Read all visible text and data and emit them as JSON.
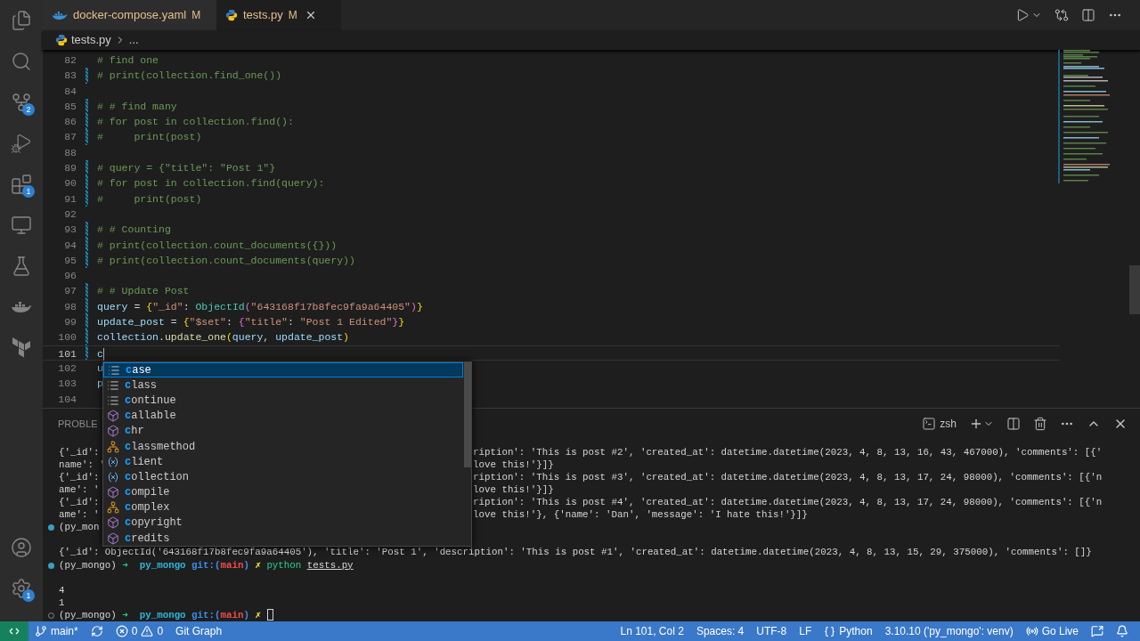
{
  "activity_bar": {
    "top": [
      {
        "kind": "explorer",
        "selected": false
      },
      {
        "kind": "search",
        "selected": false
      },
      {
        "kind": "source_control",
        "selected": false,
        "badge": "2"
      },
      {
        "kind": "run",
        "selected": false
      },
      {
        "kind": "extensions",
        "selected": false,
        "badge": "1"
      },
      {
        "kind": "remote",
        "selected": false
      },
      {
        "kind": "testing",
        "selected": false
      },
      {
        "kind": "docker",
        "selected": false
      },
      {
        "kind": "terraform",
        "selected": false
      }
    ],
    "bottom": [
      {
        "kind": "account",
        "selected": false
      },
      {
        "kind": "settings",
        "selected": false,
        "badge": "1"
      }
    ]
  },
  "tabs": [
    {
      "label": "docker-compose.yaml",
      "kind": "docker",
      "badge": "M",
      "selected": false,
      "closable": false
    },
    {
      "label": "tests.py",
      "kind": "python",
      "badge": "M",
      "selected": true,
      "closable": true
    }
  ],
  "breadcrumbs": [
    "tests.py",
    "..."
  ],
  "editor": {
    "lines": [
      {
        "number": "82",
        "changed": false,
        "current": false,
        "tokens": [
          {
            "kind": "comment",
            "text": "# find one"
          }
        ]
      },
      {
        "number": "83",
        "changed": true,
        "current": false,
        "tokens": [
          {
            "kind": "comment",
            "text": "# print(collection.find_one())"
          }
        ]
      },
      {
        "number": "84",
        "changed": false,
        "current": false
      },
      {
        "number": "85",
        "changed": true,
        "current": false,
        "tokens": [
          {
            "kind": "comment",
            "text": "# # find many"
          }
        ]
      },
      {
        "number": "86",
        "changed": true,
        "current": false,
        "tokens": [
          {
            "kind": "comment",
            "text": "# for post in collection.find():"
          }
        ]
      },
      {
        "number": "87",
        "changed": true,
        "current": false,
        "tokens": [
          {
            "kind": "comment",
            "text": "#     print(post)"
          }
        ]
      },
      {
        "number": "88",
        "changed": false,
        "current": false
      },
      {
        "number": "89",
        "changed": true,
        "current": false,
        "tokens": [
          {
            "kind": "comment",
            "text": "# query = {\"title\": \"Post 1\"}"
          }
        ]
      },
      {
        "number": "90",
        "changed": true,
        "current": false,
        "tokens": [
          {
            "kind": "comment",
            "text": "# for post in collection.find(query):"
          }
        ]
      },
      {
        "number": "91",
        "changed": true,
        "current": false,
        "tokens": [
          {
            "kind": "comment",
            "text": "#     print(post)"
          }
        ]
      },
      {
        "number": "92",
        "changed": false,
        "current": false
      },
      {
        "number": "93",
        "changed": true,
        "current": false,
        "tokens": [
          {
            "kind": "comment",
            "text": "# # Counting"
          }
        ]
      },
      {
        "number": "94",
        "changed": true,
        "current": false,
        "tokens": [
          {
            "kind": "comment",
            "text": "# print(collection.count_documents({}))"
          }
        ]
      },
      {
        "number": "95",
        "changed": true,
        "current": false,
        "tokens": [
          {
            "kind": "comment",
            "text": "# print(collection.count_documents(query))"
          }
        ]
      },
      {
        "number": "96",
        "changed": false,
        "current": false
      },
      {
        "number": "97",
        "changed": true,
        "current": false,
        "tokens": [
          {
            "kind": "comment",
            "text": "# # Update Post"
          }
        ]
      },
      {
        "number": "98",
        "changed": true,
        "current": false,
        "tokens": [
          {
            "kind": "var",
            "text": "query"
          },
          {
            "kind": "plain",
            "text": " = "
          },
          {
            "kind": "brace1",
            "text": "{"
          },
          {
            "kind": "string",
            "text": "\"_id\""
          },
          {
            "kind": "plain",
            "text": ": "
          },
          {
            "kind": "class",
            "text": "ObjectId"
          },
          {
            "kind": "brace2",
            "text": "("
          },
          {
            "kind": "string",
            "text": "\"643168f17b8fec9fa9a64405\""
          },
          {
            "kind": "brace2",
            "text": ")"
          },
          {
            "kind": "brace1",
            "text": "}"
          }
        ]
      },
      {
        "number": "99",
        "changed": true,
        "current": false,
        "tokens": [
          {
            "kind": "var",
            "text": "update_post"
          },
          {
            "kind": "plain",
            "text": " = "
          },
          {
            "kind": "brace1",
            "text": "{"
          },
          {
            "kind": "string",
            "text": "\"$set\""
          },
          {
            "kind": "plain",
            "text": ": "
          },
          {
            "kind": "brace2",
            "text": "{"
          },
          {
            "kind": "string",
            "text": "\"title\""
          },
          {
            "kind": "plain",
            "text": ": "
          },
          {
            "kind": "string",
            "text": "\"Post 1 Edited\""
          },
          {
            "kind": "brace2",
            "text": "}"
          },
          {
            "kind": "brace1",
            "text": "}"
          }
        ]
      },
      {
        "number": "100",
        "changed": true,
        "current": false,
        "tokens": [
          {
            "kind": "var",
            "text": "collection"
          },
          {
            "kind": "plain",
            "text": "."
          },
          {
            "kind": "fn",
            "text": "update_one"
          },
          {
            "kind": "brace1",
            "text": "("
          },
          {
            "kind": "var",
            "text": "query"
          },
          {
            "kind": "plain",
            "text": ", "
          },
          {
            "kind": "var",
            "text": "update_post"
          },
          {
            "kind": "brace1",
            "text": ")"
          }
        ]
      },
      {
        "number": "101",
        "changed": true,
        "current": true,
        "tokens": [
          {
            "kind": "var",
            "text": "c"
          }
        ]
      },
      {
        "number": "102",
        "changed": false,
        "current": false,
        "tokens": [
          {
            "kind": "var",
            "text": "u"
          }
        ]
      },
      {
        "number": "103",
        "changed": false,
        "current": false,
        "tokens": [
          {
            "kind": "var",
            "text": "p"
          }
        ]
      },
      {
        "number": "104",
        "changed": false,
        "current": false
      }
    ]
  },
  "suggestions": [
    {
      "kind": "keyword",
      "match": "c",
      "rest": "ase",
      "selected": true
    },
    {
      "kind": "keyword",
      "match": "c",
      "rest": "lass",
      "selected": false
    },
    {
      "kind": "keyword",
      "match": "c",
      "rest": "ontinue",
      "selected": false
    },
    {
      "kind": "function",
      "match": "c",
      "rest": "allable",
      "selected": false
    },
    {
      "kind": "function",
      "match": "c",
      "rest": "hr",
      "selected": false
    },
    {
      "kind": "class",
      "match": "c",
      "rest": "lassmethod",
      "selected": false
    },
    {
      "kind": "variable",
      "match": "c",
      "rest": "lient",
      "selected": false
    },
    {
      "kind": "variable",
      "match": "c",
      "rest": "ollection",
      "selected": false
    },
    {
      "kind": "function",
      "match": "c",
      "rest": "ompile",
      "selected": false
    },
    {
      "kind": "class",
      "match": "c",
      "rest": "omplex",
      "selected": false
    },
    {
      "kind": "function",
      "match": "c",
      "rest": "opyright",
      "selected": false
    },
    {
      "kind": "function",
      "match": "c",
      "rest": "redits",
      "selected": false
    }
  ],
  "panel": {
    "tab": "PROBLE",
    "shell": "zsh",
    "rows": [
      {
        "kind": "split",
        "left": "{'_id':",
        "right": "ription': 'This is post #2', 'created_at': datetime.datetime(2023, 4, 8, 13, 16, 43, 467000), 'comments': [{'"
      },
      {
        "kind": "split",
        "left": "name': '",
        "right": "love this!'}]}"
      },
      {
        "kind": "split",
        "left": "{'_id':",
        "right": "ription': 'This is post #3', 'created_at': datetime.datetime(2023, 4, 8, 13, 17, 24, 98000), 'comments': [{'n"
      },
      {
        "kind": "split",
        "left": "ame': '",
        "right": "love this!'}]}"
      },
      {
        "kind": "split",
        "left": "{'_id':",
        "right": "ription': 'This is post #4', 'created_at': datetime.datetime(2023, 4, 8, 13, 17, 24, 98000), 'comments': [{'n"
      },
      {
        "kind": "split",
        "left": "ame': '",
        "right": "love this!'}, {'name': 'Dan', 'message': 'I hate this!'}]}"
      },
      {
        "kind": "split",
        "done": true,
        "left": "(py_mon"
      },
      {
        "kind": "gap"
      },
      {
        "kind": "output",
        "text": "{'_id': ObjectId('643168f17b8fec9fa9a64405'), 'title': 'Post 1', 'description': 'This is post #1', 'created_at': datetime.datetime(2023, 4, 8, 13, 15, 29, 375000), 'comments': []}"
      },
      {
        "kind": "prompt",
        "done": true,
        "env": "(py_mongo)",
        "arrow": "➜",
        "dir": "py_mongo",
        "git_open": "git:(",
        "branch": "main",
        "git_close": ")",
        "dirty": "✗",
        "command": "python",
        "arg": "tests.py"
      },
      {
        "kind": "gap"
      },
      {
        "kind": "output",
        "text": "4"
      },
      {
        "kind": "output",
        "text": "1"
      },
      {
        "kind": "prompt",
        "done": false,
        "env": "(py_mongo)",
        "arrow": "➜",
        "dir": "py_mongo",
        "git_open": "git:(",
        "branch": "main",
        "git_close": ")",
        "dirty": "✗",
        "cursor": true
      }
    ]
  },
  "status_bar": {
    "left": [
      {
        "kind": "branch",
        "text": "main*"
      },
      {
        "kind": "sync"
      },
      {
        "kind": "problems",
        "errors": "0",
        "warnings": "0"
      },
      {
        "kind": "text",
        "text": "Git Graph"
      }
    ],
    "right": [
      {
        "kind": "text",
        "text": "Ln 101, Col 2"
      },
      {
        "kind": "text",
        "text": "Spaces: 4"
      },
      {
        "kind": "text",
        "text": "UTF-8"
      },
      {
        "kind": "text",
        "text": "LF"
      },
      {
        "kind": "language",
        "text": "Python"
      },
      {
        "kind": "text",
        "text": "3.10.10 ('py_mongo': venv)"
      },
      {
        "kind": "live",
        "text": "Go Live"
      },
      {
        "kind": "feedback"
      },
      {
        "kind": "bell"
      }
    ]
  }
}
